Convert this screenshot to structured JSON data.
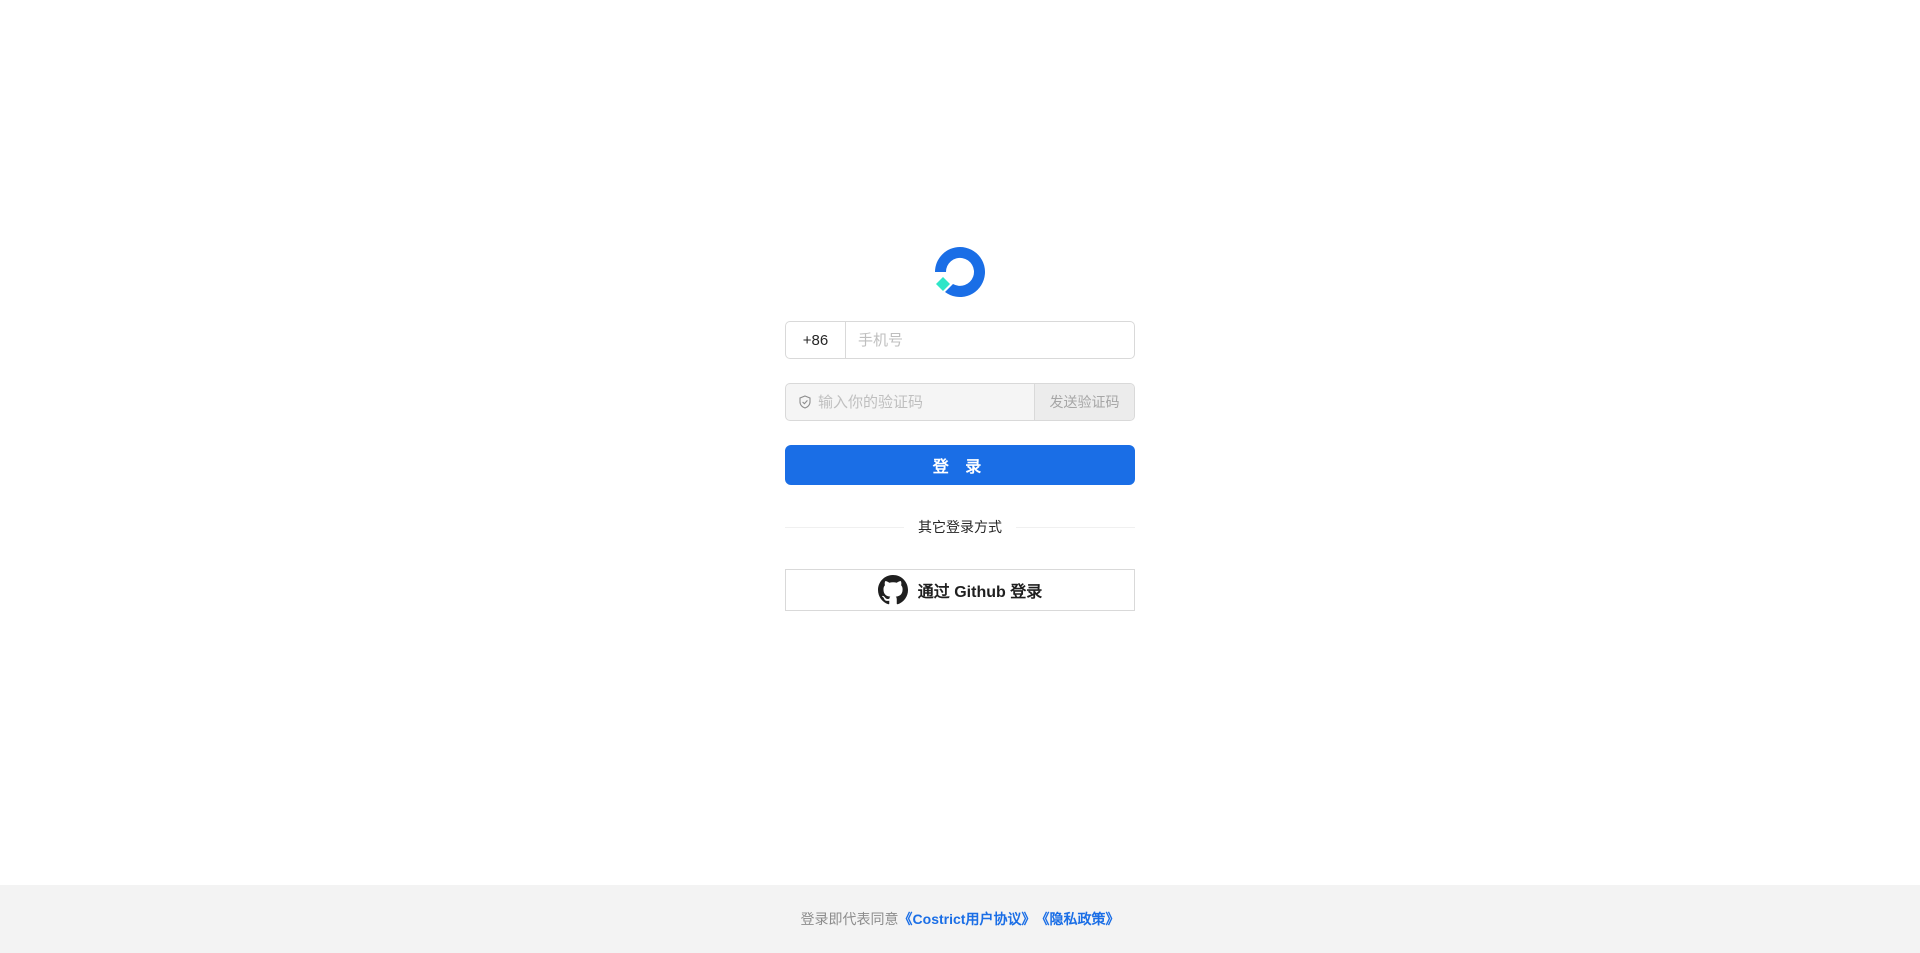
{
  "login": {
    "country_code": "+86",
    "phone_placeholder": "手机号",
    "code_placeholder": "输入你的验证码",
    "send_code_label": "发送验证码",
    "submit_label": "登 录",
    "divider_text": "其它登录方式",
    "github_label": "通过 Github 登录"
  },
  "footer": {
    "prefix": "登录即代表同意",
    "terms_link": "《Costrict用户协议》",
    "privacy_link": "《隐私政策》"
  },
  "colors": {
    "brand_blue": "#1a6ee6",
    "logo_accent": "#2ee6c8",
    "footer_bg": "#f3f3f3"
  },
  "icons": {
    "logo": "costrict-logo",
    "code_field": "shield-check-icon",
    "github": "github-icon"
  }
}
